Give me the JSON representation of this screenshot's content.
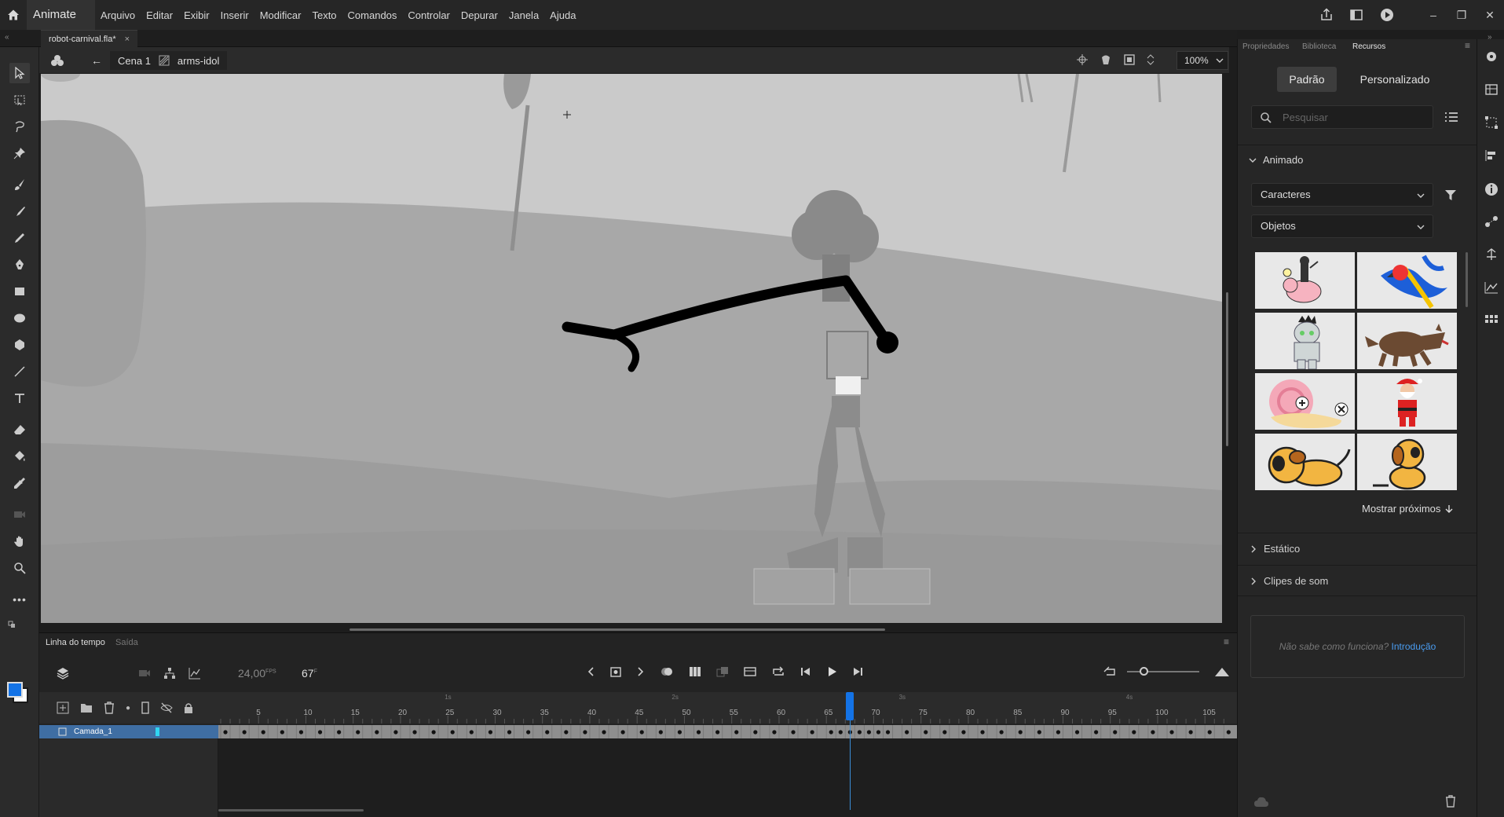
{
  "app": {
    "name": "Animate"
  },
  "menu": [
    "Arquivo",
    "Editar",
    "Exibir",
    "Inserir",
    "Modificar",
    "Texto",
    "Comandos",
    "Controlar",
    "Depurar",
    "Janela",
    "Ajuda"
  ],
  "document": {
    "tab_title": "robot-carnival.fla*",
    "close": "×"
  },
  "editbar": {
    "scene": "Cena 1",
    "symbol": "arms-idol",
    "zoom": "100%"
  },
  "timeline": {
    "tab_timeline": "Linha do tempo",
    "tab_output": "Saída",
    "fps": "24,00",
    "fps_unit": "FPS",
    "frame": "67",
    "frame_unit": "F",
    "layer": "Camada_1",
    "seconds": [
      "1s",
      "2s",
      "3s",
      "4s"
    ],
    "frame_numbers": [
      "5",
      "10",
      "15",
      "20",
      "25",
      "30",
      "35",
      "40",
      "45",
      "50",
      "55",
      "60",
      "65",
      "70",
      "75",
      "80",
      "85",
      "90",
      "95",
      "100",
      "105"
    ],
    "playhead_frame": 67,
    "total_frames_visible": 107
  },
  "panel": {
    "tabs": [
      "Propriedades",
      "Biblioteca",
      "Recursos"
    ],
    "active_tab": "Recursos",
    "mode_default": "Padrão",
    "mode_custom": "Personalizado",
    "search_placeholder": "Pesquisar",
    "section_animated": "Animado",
    "filter_category": "Caracteres",
    "filter_type": "Objetos",
    "show_next": "Mostrar próximos",
    "section_static": "Estático",
    "section_sound": "Clipes de som",
    "help_text": "Não sabe como funciona?",
    "help_link": "Introdução"
  },
  "colors": {
    "accent": "#1473e6",
    "stroke_color": "#1a1a1a",
    "fill_color": "#1473e6",
    "link": "#4a9cf0"
  },
  "assets": [
    {
      "name": "pig-rider"
    },
    {
      "name": "parrot"
    },
    {
      "name": "mummy"
    },
    {
      "name": "wolf"
    },
    {
      "name": "snail"
    },
    {
      "name": "santa"
    },
    {
      "name": "dog-lying"
    },
    {
      "name": "dog-sitting"
    }
  ]
}
